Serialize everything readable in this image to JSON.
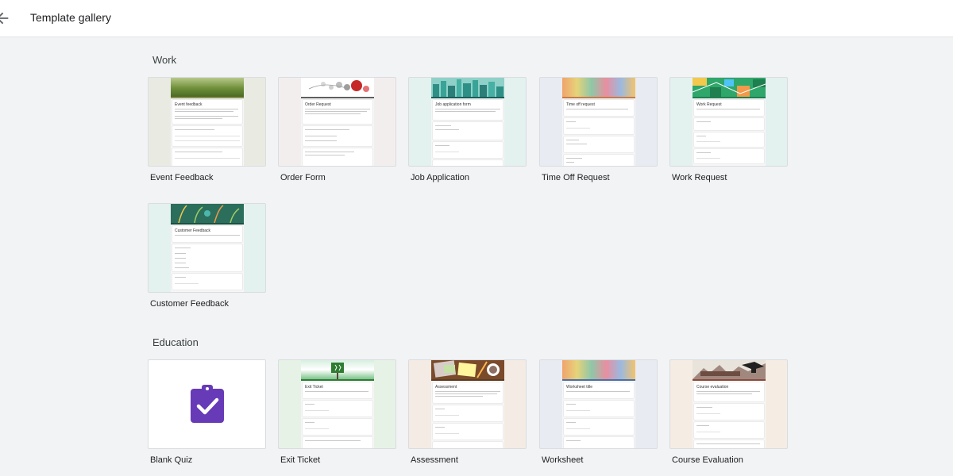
{
  "header": {
    "title": "Template gallery"
  },
  "sections": {
    "work": {
      "title": "Work",
      "cards": [
        {
          "label": "Event Feedback",
          "form_title": "Event feedback"
        },
        {
          "label": "Order Form",
          "form_title": "Order Request"
        },
        {
          "label": "Job Application",
          "form_title": "Job application form"
        },
        {
          "label": "Time Off Request",
          "form_title": "Time off request"
        },
        {
          "label": "Work Request",
          "form_title": "Work Request"
        },
        {
          "label": "Customer Feedback",
          "form_title": "Customer Feedback"
        }
      ]
    },
    "education": {
      "title": "Education",
      "cards": [
        {
          "label": "Blank Quiz"
        },
        {
          "label": "Exit Ticket",
          "form_title": "Exit Ticket"
        },
        {
          "label": "Assessment",
          "form_title": "Assessment"
        },
        {
          "label": "Worksheet",
          "form_title": "Worksheet title"
        },
        {
          "label": "Course Evaluation",
          "form_title": "Course evaluation"
        }
      ]
    }
  },
  "colors": {
    "page_bg": "#f1f3f4",
    "quiz_icon": "#673ab7"
  }
}
